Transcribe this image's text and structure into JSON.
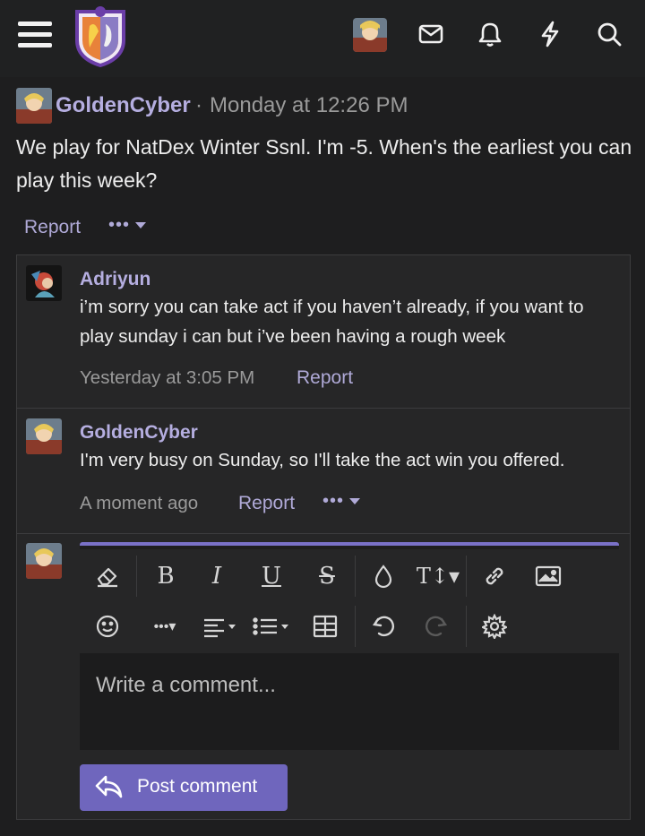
{
  "header": {
    "menu_icon": "hamburger-icon",
    "logo_icon": "forum-logo",
    "icons": [
      "inbox-icon",
      "bell-icon",
      "lightning-icon",
      "search-icon"
    ]
  },
  "post": {
    "author": "GoldenCyber",
    "separator": "·",
    "timestamp": "Monday at 12:26 PM",
    "body": "We play for NatDex Winter Ssnl. I'm -5. When's the earliest you can play this week?",
    "report_label": "Report",
    "more_label": "•••"
  },
  "comments": [
    {
      "author": "Adriyun",
      "text": "i’m sorry you can take act if you haven’t already, if you want to play sunday i can but i’ve been having a rough week",
      "time": "Yesterday at 3:05 PM",
      "report_label": "Report"
    },
    {
      "author": "GoldenCyber",
      "text": "I'm very busy on Sunday, so I'll take the act win you offered.",
      "time": "A moment ago",
      "report_label": "Report",
      "more_label": "•••"
    }
  ],
  "editor": {
    "placeholder": "Write a comment...",
    "submit_label": "Post comment",
    "toolbar": [
      "eraser-icon",
      "bold-icon",
      "italic-icon",
      "underline-icon",
      "strikethrough-icon",
      "color-drop-icon",
      "text-size-icon",
      "link-icon",
      "image-icon",
      "emoji-icon",
      "more-icon",
      "align-icon",
      "list-icon",
      "table-icon",
      "undo-icon",
      "redo-icon",
      "settings-icon"
    ]
  },
  "colors": {
    "accent": "#6f66bd",
    "username": "#b5aee0",
    "background": "#1e1e1f"
  }
}
